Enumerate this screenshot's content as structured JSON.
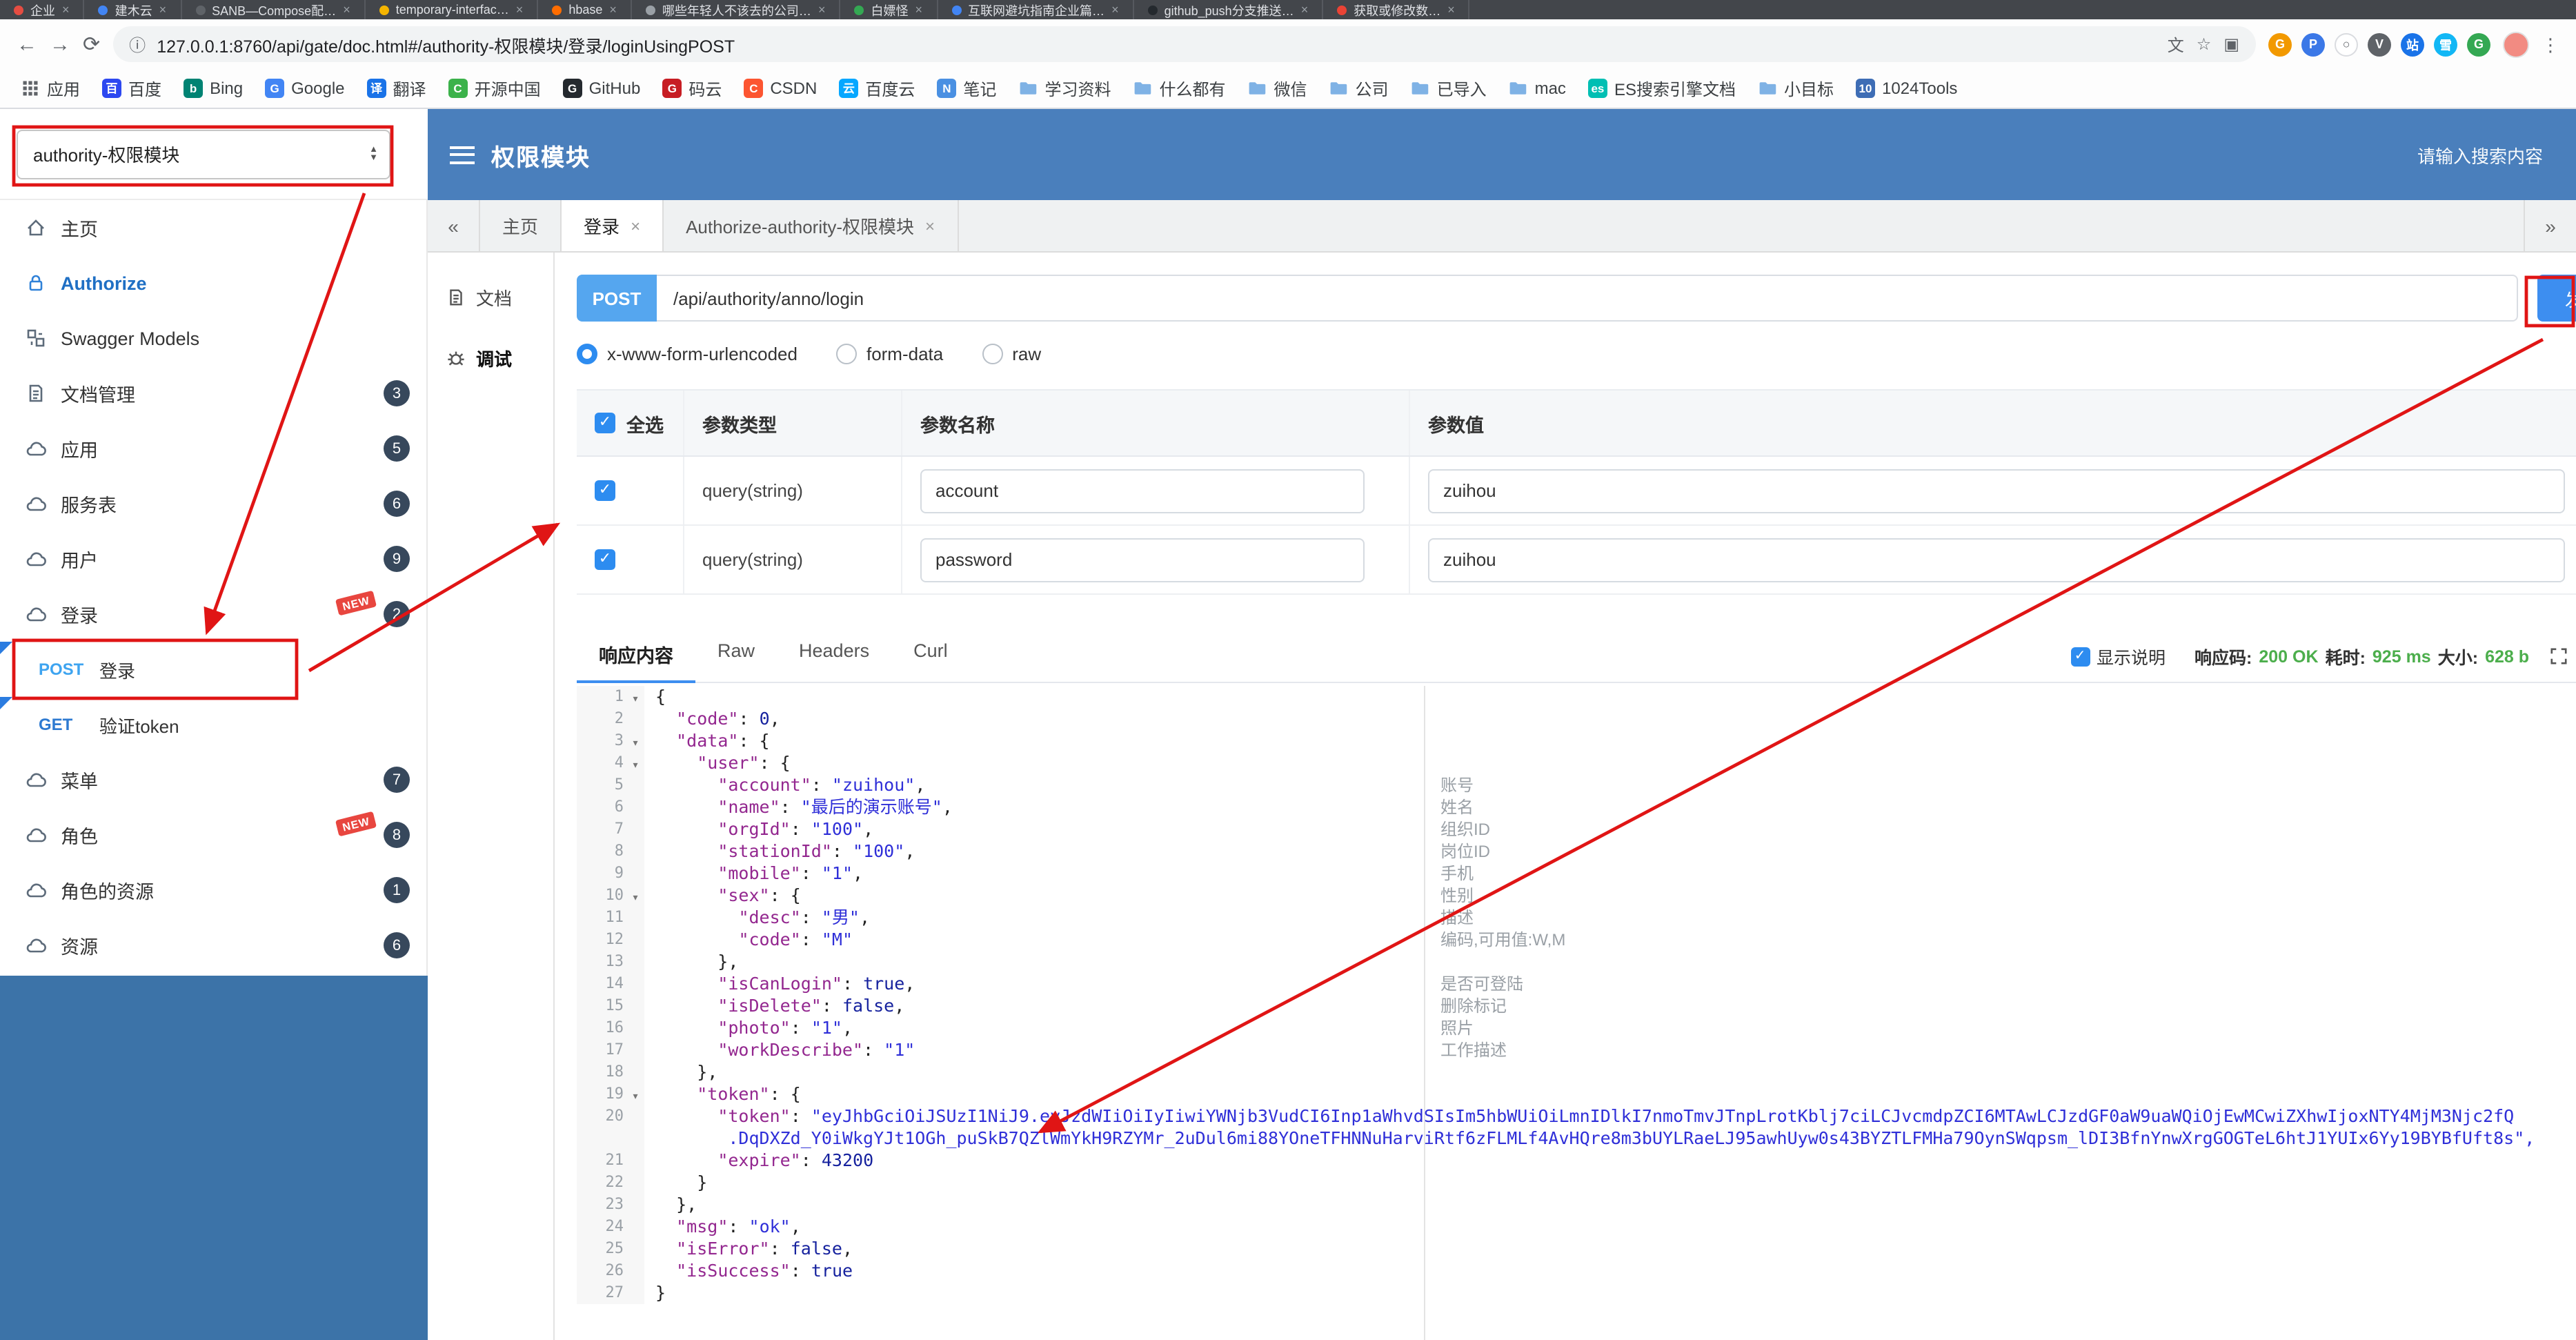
{
  "colors": {
    "header_blue": "#4a7fbc",
    "sidebar_blue": "#3c73a8",
    "accent_blue": "#2d8cf0",
    "method_post": "#3ea4f0",
    "method_get": "#2e7ad1",
    "status_green": "#4cae4c",
    "annotation_red": "#e01515",
    "badge_navy": "#37485c",
    "post_badge_blue": "#55a6ef",
    "send_button_blue": "#3d8ef0"
  },
  "browser": {
    "close_glyph": "×",
    "info_glyph": "ⓘ",
    "translate_glyph": "文",
    "star_glyph": "☆",
    "screenshot_glyph": "▣",
    "menu_glyph": "⋮",
    "nav": [
      "←",
      "→",
      "⟳"
    ],
    "url": "127.0.0.1:8760/api/gate/doc.html#/authority-权限模块/登录/loginUsingPOST",
    "tabs": [
      {
        "title": "企业",
        "fav": "#e54d42"
      },
      {
        "title": "建木云",
        "fav": "#4285f4"
      },
      {
        "title": "SANB—Compose配…",
        "fav": "#5f6368"
      },
      {
        "title": "temporary-interfac…",
        "fav": "#f4b400"
      },
      {
        "title": "hbase",
        "fav": "#ff6d00"
      },
      {
        "title": "哪些年轻人不该去的公司…",
        "fav": "#9aa0a6"
      },
      {
        "title": "白嫖怪",
        "fav": "#34a853"
      },
      {
        "title": "互联网避坑指南企业篇…",
        "fav": "#4285f4"
      },
      {
        "title": "github_push分支推送…",
        "fav": "#24292e"
      },
      {
        "title": "获取或修改数…",
        "fav": "#ea4335"
      }
    ],
    "extensions": [
      {
        "glyph": "G",
        "bg": "#f29900"
      },
      {
        "glyph": "P",
        "bg": "#3b78e7"
      },
      {
        "glyph": "○",
        "bg": "#ffffff",
        "fg": "#5f6368",
        "border": "#dadce0"
      },
      {
        "glyph": "V",
        "bg": "#5f6368"
      },
      {
        "glyph": "站",
        "bg": "#1a73e8"
      },
      {
        "glyph": "雪",
        "bg": "#12b7f5"
      },
      {
        "glyph": "G",
        "bg": "#34a853"
      }
    ],
    "bookmarks": [
      {
        "label": "应用",
        "apps": true
      },
      {
        "label": "百度",
        "letter": "百",
        "color": "#2d48f0"
      },
      {
        "label": "Bing",
        "letter": "b",
        "color": "#008373"
      },
      {
        "label": "Google",
        "letter": "G",
        "color": "#4285f4"
      },
      {
        "label": "翻译",
        "letter": "译",
        "color": "#1a73e8"
      },
      {
        "label": "开源中国",
        "letter": "C",
        "color": "#3bb24a"
      },
      {
        "label": "GitHub",
        "letter": "G",
        "color": "#24292e"
      },
      {
        "label": "码云",
        "letter": "G",
        "color": "#c71d23"
      },
      {
        "label": "CSDN",
        "letter": "C",
        "color": "#fc5531"
      },
      {
        "label": "百度云",
        "letter": "云",
        "color": "#06a7ff"
      },
      {
        "label": "笔记",
        "letter": "N",
        "color": "#4a90e2"
      },
      {
        "label": "学习资料",
        "folder": true
      },
      {
        "label": "什么都有",
        "folder": true
      },
      {
        "label": "微信",
        "folder": true
      },
      {
        "label": "公司",
        "folder": true
      },
      {
        "label": "已导入",
        "folder": true
      },
      {
        "label": "mac",
        "folder": true
      },
      {
        "label": "ES搜索引擎文档",
        "letter": "es",
        "color": "#00bfb3"
      },
      {
        "label": "小目标",
        "folder": true
      },
      {
        "label": "1024Tools",
        "letter": "10",
        "color": "#3e6db5"
      }
    ]
  },
  "header": {
    "title": "权限模块",
    "search_placeholder": "请输入搜索内容"
  },
  "sidebar": {
    "select_value": "authority-权限模块",
    "select_up": "▲",
    "select_down": "▼",
    "new_label": "NEW",
    "items": [
      {
        "label": "主页",
        "icon": "home"
      },
      {
        "label": "Authorize",
        "icon": "lock",
        "accent": true
      },
      {
        "label": "Swagger Models",
        "icon": "models"
      },
      {
        "label": "文档管理",
        "icon": "doc",
        "badge": "3"
      },
      {
        "label": "应用",
        "icon": "cloud",
        "badge": "5"
      },
      {
        "label": "服务表",
        "icon": "cloud",
        "badge": "6"
      },
      {
        "label": "用户",
        "icon": "cloud",
        "badge": "9"
      },
      {
        "label": "登录",
        "icon": "cloud",
        "badge": "2",
        "isNew": true
      },
      {
        "label": "登录",
        "method": "POST",
        "child": true,
        "flag": true
      },
      {
        "label": "验证token",
        "method": "GET",
        "child": true,
        "flag": true,
        "isGet": true
      },
      {
        "label": "菜单",
        "icon": "cloud",
        "badge": "7"
      },
      {
        "label": "角色",
        "icon": "cloud",
        "badge": "8",
        "isNew": true
      },
      {
        "label": "角色的资源",
        "icon": "cloud",
        "badge": "1"
      },
      {
        "label": "资源",
        "icon": "cloud",
        "badge": "6"
      }
    ]
  },
  "content": {
    "tabs_bar": {
      "left_arrow": "«",
      "right_arrow": "»",
      "close_glyph": "×",
      "tabs": [
        {
          "label": "主页",
          "closable": false
        },
        {
          "label": "登录",
          "closable": true,
          "active": true
        },
        {
          "label": "Authorize-authority-权限模块",
          "closable": true
        }
      ]
    },
    "side_tabs": [
      {
        "label": "文档",
        "icon": "file"
      },
      {
        "label": "调试",
        "icon": "bug",
        "active": true
      }
    ],
    "request": {
      "method": "POST",
      "url": "/api/authority/anno/login",
      "send_label": "发送",
      "body_types": [
        {
          "label": "x-www-form-urlencoded",
          "selected": true
        },
        {
          "label": "form-data"
        },
        {
          "label": "raw"
        }
      ],
      "params_table": {
        "check_glyph": "✓",
        "headers": [
          "全选",
          "参数类型",
          "参数名称",
          "参数值"
        ],
        "rows": [
          {
            "checked": true,
            "type": "query(string)",
            "name": "account",
            "value": "zuihou"
          },
          {
            "checked": true,
            "type": "query(string)",
            "name": "password",
            "value": "zuihou"
          }
        ]
      }
    },
    "response": {
      "tabs": [
        {
          "label": "响应内容",
          "active": true
        },
        {
          "label": "Raw"
        },
        {
          "label": "Headers"
        },
        {
          "label": "Curl"
        }
      ],
      "show_desc_label": "显示说明",
      "status": {
        "code_label": "响应码:",
        "code": "200 OK",
        "time_label": "耗时:",
        "time": "925 ms",
        "size_label": "大小:",
        "size": "628 b"
      },
      "fold_glyph": "▾",
      "code_rows": [
        {
          "n": "1",
          "fold": true,
          "text": "{"
        },
        {
          "n": "2",
          "text": "  \"code\": 0,"
        },
        {
          "n": "3",
          "fold": true,
          "text": "  \"data\": {"
        },
        {
          "n": "4",
          "fold": true,
          "text": "    \"user\": {"
        },
        {
          "n": "5",
          "text": "      \"account\": \"zuihou\",",
          "ann": "账号"
        },
        {
          "n": "6",
          "text": "      \"name\": \"最后的演示账号\",",
          "ann": "姓名"
        },
        {
          "n": "7",
          "text": "      \"orgId\": \"100\",",
          "ann": "组织ID"
        },
        {
          "n": "8",
          "text": "      \"stationId\": \"100\",",
          "ann": "岗位ID"
        },
        {
          "n": "9",
          "text": "      \"mobile\": \"1\",",
          "ann": "手机"
        },
        {
          "n": "10",
          "fold": true,
          "text": "      \"sex\": {",
          "ann": "性别"
        },
        {
          "n": "11",
          "text": "        \"desc\": \"男\",",
          "ann": "描述"
        },
        {
          "n": "12",
          "text": "        \"code\": \"M\"",
          "ann": "编码,可用值:W,M"
        },
        {
          "n": "13",
          "text": "      },"
        },
        {
          "n": "14",
          "text": "      \"isCanLogin\": true,",
          "ann": "是否可登陆"
        },
        {
          "n": "15",
          "text": "      \"isDelete\": false,",
          "ann": "删除标记"
        },
        {
          "n": "16",
          "text": "      \"photo\": \"1\",",
          "ann": "照片"
        },
        {
          "n": "17",
          "text": "      \"workDescribe\": \"1\"",
          "ann": "工作描述"
        },
        {
          "n": "18",
          "text": "    },"
        },
        {
          "n": "19",
          "fold": true,
          "text": "    \"token\": {"
        },
        {
          "n": "20",
          "text": "      \"token\": \"eyJhbGciOiJSUzI1NiJ9.eyJzdWIiOiIyIiwiYWNjb3VudCI6Inp1aWhvdSIsIm5hbWUiOiLmnIDlkI7nmoTmvJTnpLrotKblj7ciLCJvcmdpZCI6MTAwLCJzdGF0aW9uaWQiOjEwMCwiZXhwIjoxNTY4MjM3Njc2fQ"
        },
        {
          "n": "",
          "text": "       .DqDXZd_Y0iWkgYJt1OGh_puSkB7QZlWmYkH9RZYMr_2uDul6mi88YOneTFHNNuHarviRtf6zFLMLf4AvHQre8m3bUYLRaeLJ95awhUyw0s43BYZTLFMHa79OynSWqpsm_lDI3BfnYnwXrgGOGTeL6htJ1YUIx6Yy19BYBfUft8s\","
        },
        {
          "n": "21",
          "text": "      \"expire\": 43200"
        },
        {
          "n": "22",
          "text": "    }"
        },
        {
          "n": "23",
          "text": "  },"
        },
        {
          "n": "24",
          "text": "  \"msg\": \"ok\","
        },
        {
          "n": "25",
          "text": "  \"isError\": false,"
        },
        {
          "n": "26",
          "text": "  \"isSuccess\": true"
        },
        {
          "n": "27",
          "text": "}"
        }
      ]
    }
  },
  "annotations": {
    "color": "#e01515"
  }
}
